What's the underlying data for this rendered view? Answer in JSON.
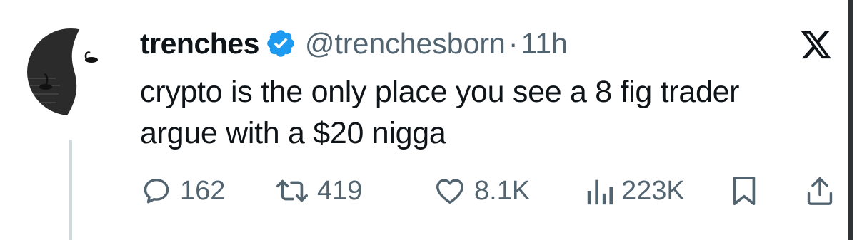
{
  "tweet": {
    "author_name": "trenches",
    "handle": "@trenchesborn",
    "separator": "·",
    "time": "11h",
    "text_lines": [
      "crypto is the only place you see a 8 fig trader",
      "argue with a $20 nigga"
    ]
  },
  "actions": {
    "replies": "162",
    "reposts": "419",
    "likes": "8.1K",
    "views": "223K"
  },
  "icons": {
    "verified": "verified-badge-icon",
    "platform": "x-logo-icon",
    "reply": "reply-icon",
    "repost": "repost-icon",
    "like": "heart-icon",
    "views": "views-chart-icon",
    "bookmark": "bookmark-icon",
    "share": "share-icon"
  },
  "colors": {
    "text": "#0f1419",
    "secondary": "#536471",
    "verified": "#1d9bf0"
  }
}
